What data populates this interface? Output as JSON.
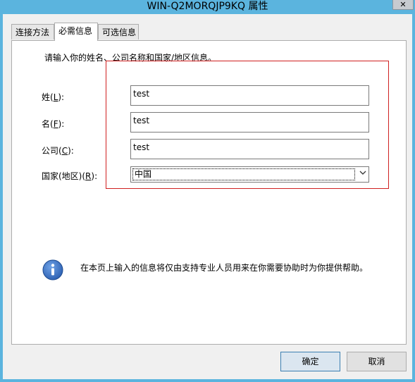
{
  "window": {
    "title": "WIN-Q2MORQJP9KQ 属性",
    "close_glyph": "✕"
  },
  "tabs": [
    {
      "label": "连接方法",
      "active": false
    },
    {
      "label": "必需信息",
      "active": true
    },
    {
      "label": "可选信息",
      "active": false
    }
  ],
  "form": {
    "instruction": "请输入你的姓名、公司名称和国家/地区信息。",
    "last_name": {
      "label_pre": "姓(",
      "accel": "L",
      "label_post": "):",
      "value": "test"
    },
    "first_name": {
      "label_pre": "名(",
      "accel": "F",
      "label_post": "):",
      "value": "test"
    },
    "company": {
      "label_pre": "公司(",
      "accel": "C",
      "label_post": "):",
      "value": "test"
    },
    "country": {
      "label_pre": "国家(地区)(",
      "accel": "R",
      "label_post": "):",
      "value": "中国"
    }
  },
  "info": {
    "icon": "info-icon",
    "text": "在本页上输入的信息将仅由支持专业人员用来在你需要协助时为你提供帮助。"
  },
  "buttons": {
    "ok": "确定",
    "cancel": "取消"
  },
  "colors": {
    "title_bar": "#5bb4de",
    "highlight_box": "#d02020",
    "info_icon": "#2f63b5"
  }
}
